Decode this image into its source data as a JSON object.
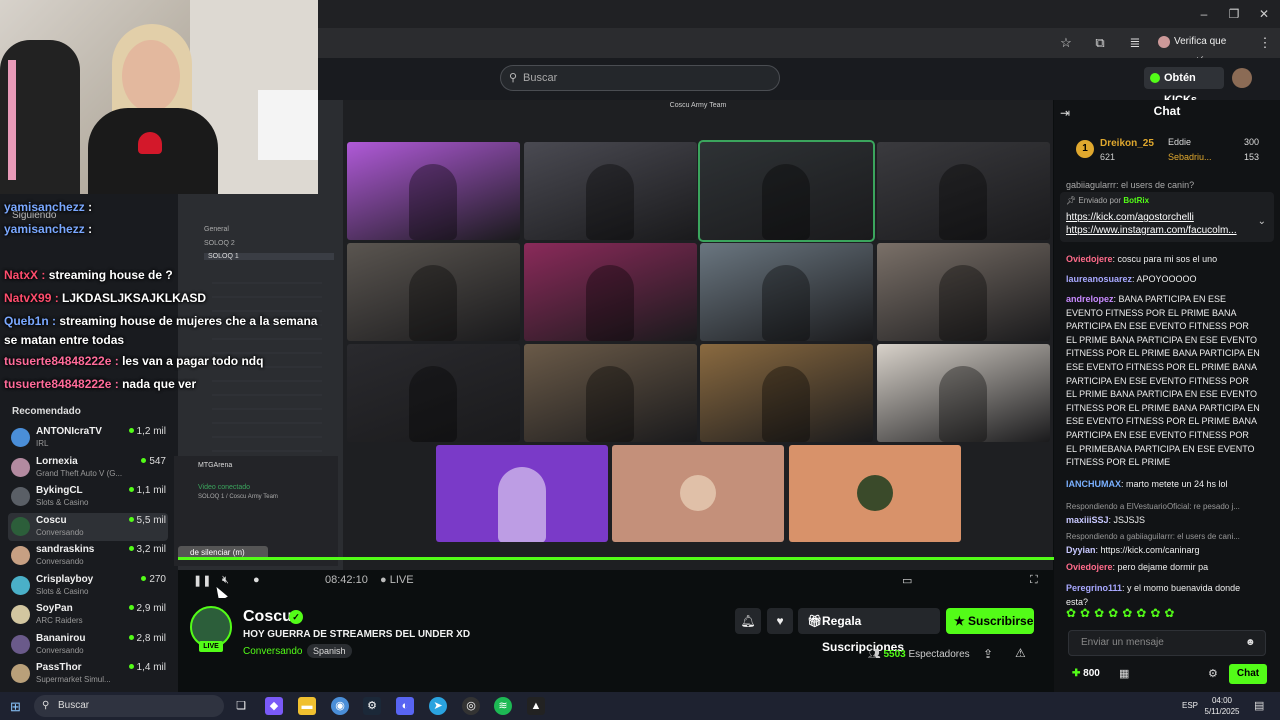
{
  "browser": {
    "verify_label": "Verifica que eres tú"
  },
  "kick": {
    "search_placeholder": "Buscar",
    "kicks_label": "Obtén KICKs"
  },
  "sidebar": {
    "following_label": "Siguiendo",
    "recommended_label": "Recomendado",
    "recommended": [
      {
        "name": "ANTONIcraTV",
        "category": "IRL",
        "viewers": "1,2 mil",
        "color": "#4a8ed8"
      },
      {
        "name": "Lornexia",
        "category": "Grand Theft Auto V (G...",
        "viewers": "547",
        "color": "#b38aa0"
      },
      {
        "name": "BykingCL",
        "category": "Slots & Casino",
        "viewers": "1,1 mil",
        "color": "#5a5f66"
      },
      {
        "name": "Coscu",
        "category": "Conversando",
        "viewers": "5,5 mil",
        "color": "#2c5e3a"
      },
      {
        "name": "sandraskins",
        "category": "Conversando",
        "viewers": "3,2 mil",
        "color": "#c7a083"
      },
      {
        "name": "Crisplayboy",
        "category": "Slots & Casino",
        "viewers": "270",
        "color": "#4ab0c8"
      },
      {
        "name": "SoyPan",
        "category": "ARC Raiders",
        "viewers": "2,9 mil",
        "color": "#d2c6a0"
      },
      {
        "name": "Bananirou",
        "category": "Conversando",
        "viewers": "2,8 mil",
        "color": "#6a5a8a"
      },
      {
        "name": "PassThor",
        "category": "Supermarket Simul...",
        "viewers": "1,4 mil",
        "color": "#b9a07a"
      }
    ]
  },
  "overlay_chat": [
    {
      "user": "yamisanchezz",
      "msg": ":",
      "color": "#7aa8ff"
    },
    {
      "user": "yamisanchezz",
      "msg": ":",
      "color": "#7aa8ff"
    },
    {
      "user": "NatxX :",
      "msg": "streaming house de ?",
      "color": "#ff4d6d"
    },
    {
      "user": "NatvX99 :",
      "msg": "LJKDASLJKSAJKLKASD",
      "color": "#ff4d6d"
    },
    {
      "user": "Queb1n :",
      "msg": "streaming house de mujeres che a la semana",
      "color": "#7aa8ff"
    },
    {
      "user": "",
      "msg": "se matan entre todas",
      "color": "#fff"
    },
    {
      "user": "tusuerte84848222e :",
      "msg": "les van a pagar todo ndq",
      "color": "#ff6b9a"
    },
    {
      "user": "tusuerte84848222e :",
      "msg": "nada que ver",
      "color": "#ff6b9a"
    }
  ],
  "discord": {
    "server_label": "MTGArena",
    "video_connected": "Video conectado",
    "channel_path": "SOLOQ 1 / Coscu Army Team",
    "call_title": "Coscu Army Team",
    "channels": [
      "General",
      "SOLOQ 2",
      "SOLOQ 1"
    ],
    "push_to_talk": "de silenciar (m)"
  },
  "player": {
    "time": "08:42:10",
    "live": "LIVE"
  },
  "channel": {
    "name": "Coscu",
    "live_badge": "LIVE",
    "title": "HOY GUERRA DE STREAMERS DEL UNDER XD",
    "category": "Conversando",
    "language": "Spanish",
    "gift_label": "Regala Suscripciones",
    "subscribe_label": "Suscribirse",
    "viewers_count": "5503",
    "viewers_label": "Espectadores"
  },
  "chat": {
    "title": "Chat",
    "leaderboard": [
      {
        "rank": "1",
        "name": "Dreikon_25",
        "value": "621"
      },
      {
        "name": "Eddie",
        "value": "300"
      },
      {
        "name": "Sebadriu...",
        "value": "153"
      }
    ],
    "pinned_by_label": "Enviado por",
    "pinned_by_user": "BotRix",
    "pinned_link1": "https://kick.com/agostorchelli",
    "pinned_link2": "https://www.instagram.com/facucolm...",
    "messages": [
      {
        "user": "Oviedojere",
        "text": ": coscu para mi sos el uno",
        "color": "#ff6b8a"
      },
      {
        "user": "laureanosuarez",
        "text": ": APOYOOOOO",
        "color": "#a8a8ff"
      },
      {
        "user": "andrelopez",
        "text": ": BANA PARTICIPA EN ESE EVENTO FITNESS POR EL PRIME BANA PARTICIPA EN ESE EVENTO FITNESS POR EL PRIME BANA PARTICIPA EN ESE EVENTO FITNESS POR EL PRIME BANA PARTICIPA EN ESE EVENTO FITNESS POR EL PRIME BANA PARTICIPA EN ESE EVENTO FITNESS POR EL PRIME BANA PARTICIPA EN ESE EVENTO FITNESS POR EL PRIME BANA PARTICIPA EN ESE EVENTO FITNESS POR EL PRIME BANA PARTICIPA EN ESE EVENTO FITNESS POR EL PRIMEBANA PARTICIPA EN ESE EVENTO FITNESS POR EL PRIME",
        "color": "#c88aff"
      },
      {
        "user": "IANCHUMAX",
        "text": ": marto metete un 24 hs lol",
        "color": "#7ab0ff"
      },
      {
        "reply": "Respondiendo a ElVestuarioOficial: re pesado j...",
        "user": "maxiiiSSJ",
        "text": ": JSJSJS",
        "color": "#c8c8ff"
      },
      {
        "reply": "Respondiendo a gabiiaguilarrr: el users de cani...",
        "user": "Dyyian",
        "text": ": https://kick.com/caninarg",
        "color": "#c8c8ff"
      },
      {
        "user": "Oviedojere",
        "text": ": pero dejame dormir pa",
        "color": "#ff6b8a"
      },
      {
        "user": "Peregrino111",
        "text": ": y el momo buenavida donde esta?",
        "color": "#a8a8ff"
      }
    ],
    "top_partial": "gabiiagularrr: el users de canin?",
    "input_placeholder": "Enviar un mensaje",
    "points": "800",
    "send_label": "Chat"
  },
  "taskbar": {
    "search_label": "Buscar",
    "lang": "ESP",
    "time": "04:00",
    "date": "5/11/2025"
  }
}
